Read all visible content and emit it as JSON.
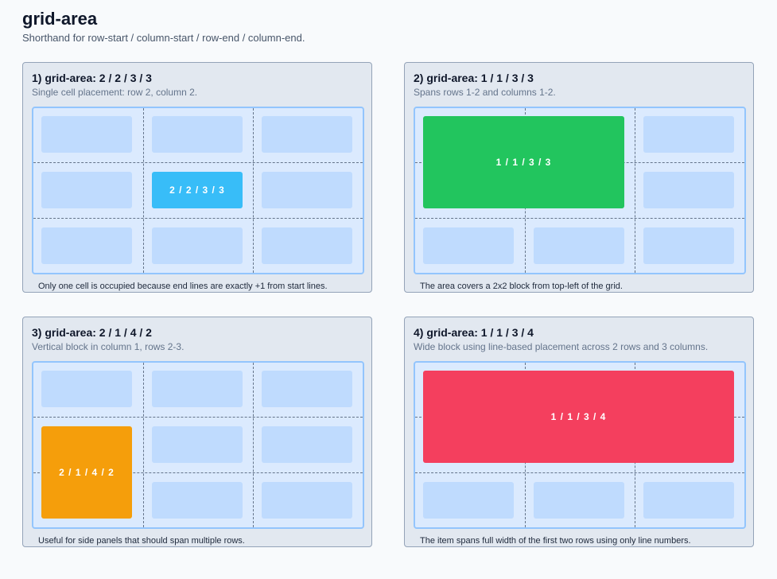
{
  "page": {
    "title": "grid-area",
    "subtitle": "Shorthand for row-start / column-start / row-end / column-end."
  },
  "examples": [
    {
      "title": "1) grid-area: 2 / 2 / 3 / 3",
      "description": "Single cell placement: row 2, column 2.",
      "item_label": "2 / 2 / 3 / 3",
      "item_color": "#38bdf8",
      "note": "Only one cell is occupied because end lines are exactly +1 from start lines."
    },
    {
      "title": "2) grid-area: 1 / 1 / 3 / 3",
      "description": "Spans rows 1-2 and columns 1-2.",
      "item_label": "1 / 1 / 3 / 3",
      "item_color": "#22c55e",
      "note": "The area covers a 2x2 block from top-left of the grid."
    },
    {
      "title": "3) grid-area: 2 / 1 / 4 / 2",
      "description": "Vertical block in column 1, rows 2-3.",
      "item_label": "2 / 1 / 4 / 2",
      "item_color": "#f59e0b",
      "note": "Useful for side panels that should span multiple rows."
    },
    {
      "title": "4) grid-area: 1 / 1 / 3 / 4",
      "description": "Wide block using line-based placement across 2 rows and 3 columns.",
      "item_label": "1 / 1 / 3 / 4",
      "item_color": "#f43f5e",
      "note": "The item spans full width of the first two rows using only line numbers."
    }
  ]
}
